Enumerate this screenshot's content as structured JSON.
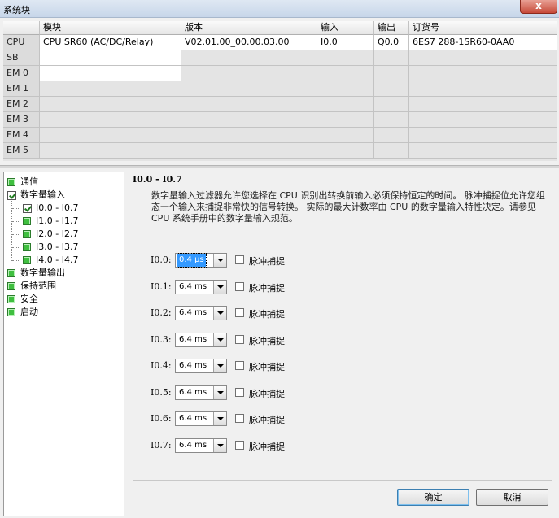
{
  "window": {
    "title": "系统块",
    "close": "x"
  },
  "grid": {
    "columns": [
      "模块",
      "版本",
      "输入",
      "输出",
      "订货号"
    ],
    "rows": [
      {
        "slot": "CPU",
        "module": "CPU SR60 (AC/DC/Relay)",
        "version": "V02.01.00_00.00.03.00",
        "input": "I0.0",
        "output": "Q0.0",
        "order": "6ES7 288-1SR60-0AA0"
      },
      {
        "slot": "SB",
        "module": "",
        "version": "",
        "input": "",
        "output": "",
        "order": ""
      },
      {
        "slot": "EM 0",
        "module": "",
        "version": "",
        "input": "",
        "output": "",
        "order": ""
      },
      {
        "slot": "EM 1",
        "module": "",
        "version": "",
        "input": "",
        "output": "",
        "order": ""
      },
      {
        "slot": "EM 2",
        "module": "",
        "version": "",
        "input": "",
        "output": "",
        "order": ""
      },
      {
        "slot": "EM 3",
        "module": "",
        "version": "",
        "input": "",
        "output": "",
        "order": ""
      },
      {
        "slot": "EM 4",
        "module": "",
        "version": "",
        "input": "",
        "output": "",
        "order": ""
      },
      {
        "slot": "EM 5",
        "module": "",
        "version": "",
        "input": "",
        "output": "",
        "order": ""
      }
    ]
  },
  "tree": {
    "comm": "通信",
    "dinput": "数字量输入",
    "groups": [
      "I0.0 - I0.7",
      "I1.0 - I1.7",
      "I2.0 - I2.7",
      "I3.0 - I3.7",
      "I4.0 - I4.7"
    ],
    "doutput": "数字量输出",
    "retain": "保持范围",
    "security": "安全",
    "startup": "启动"
  },
  "panel": {
    "title": "I0.0 - I0.7",
    "description": "数字量输入过滤器允许您选择在 CPU 识别出转换前输入必须保持恒定的时间。 脉冲捕捉位允许您组态一个输入来捕捉非常快的信号转换。 实际的最大计数率由 CPU 的数字量输入特性决定。请参见 CPU 系统手册中的数字量输入规范。",
    "pulse_label": "脉冲捕捉",
    "inputs": [
      {
        "label": "I0.0:",
        "value": "0.4 μs"
      },
      {
        "label": "I0.1:",
        "value": "6.4 ms"
      },
      {
        "label": "I0.2:",
        "value": "6.4 ms"
      },
      {
        "label": "I0.3:",
        "value": "6.4 ms"
      },
      {
        "label": "I0.4:",
        "value": "6.4 ms"
      },
      {
        "label": "I0.5:",
        "value": "6.4 ms"
      },
      {
        "label": "I0.6:",
        "value": "6.4 ms"
      },
      {
        "label": "I0.7:",
        "value": "6.4 ms"
      }
    ]
  },
  "buttons": {
    "ok": "确定",
    "cancel": "取消"
  }
}
